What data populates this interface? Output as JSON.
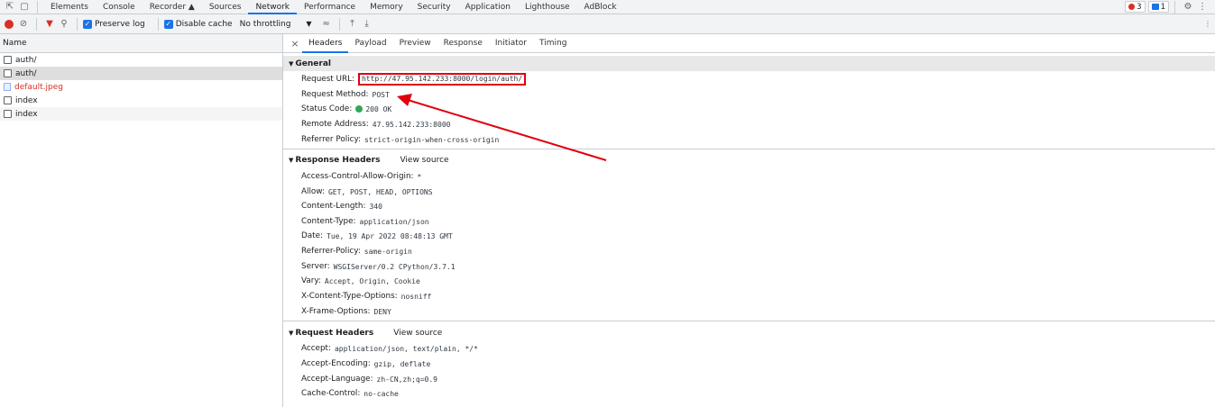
{
  "main_tabs": [
    "Elements",
    "Console",
    "Recorder",
    "Sources",
    "Network",
    "Performance",
    "Memory",
    "Security",
    "Application",
    "Lighthouse",
    "AdBlock"
  ],
  "status": {
    "errors": "3",
    "messages": "1"
  },
  "toolbar": {
    "preserve_log": "Preserve log",
    "disable_cache": "Disable cache",
    "throttling": "No throttling"
  },
  "requests": {
    "header": "Name",
    "items": [
      "auth/",
      "auth/",
      "default.jpeg",
      "index",
      "index"
    ]
  },
  "detail_tabs": [
    "Headers",
    "Payload",
    "Preview",
    "Response",
    "Initiator",
    "Timing"
  ],
  "general": {
    "title": "General",
    "rows": [
      {
        "k": "Request URL:",
        "v": "http://47.95.142.233:8000/login/auth/"
      },
      {
        "k": "Request Method:",
        "v": "POST"
      },
      {
        "k": "Status Code:",
        "v": "200 OK"
      },
      {
        "k": "Remote Address:",
        "v": "47.95.142.233:8000"
      },
      {
        "k": "Referrer Policy:",
        "v": "strict-origin-when-cross-origin"
      }
    ]
  },
  "response_headers": {
    "title": "Response Headers",
    "view_source": "View source",
    "rows": [
      {
        "k": "Access-Control-Allow-Origin:",
        "v": "*"
      },
      {
        "k": "Allow:",
        "v": "GET, POST, HEAD, OPTIONS"
      },
      {
        "k": "Content-Length:",
        "v": "340"
      },
      {
        "k": "Content-Type:",
        "v": "application/json"
      },
      {
        "k": "Date:",
        "v": "Tue, 19 Apr 2022 08:48:13 GMT"
      },
      {
        "k": "Referrer-Policy:",
        "v": "same-origin"
      },
      {
        "k": "Server:",
        "v": "WSGIServer/0.2 CPython/3.7.1"
      },
      {
        "k": "Vary:",
        "v": "Accept, Origin, Cookie"
      },
      {
        "k": "X-Content-Type-Options:",
        "v": "nosniff"
      },
      {
        "k": "X-Frame-Options:",
        "v": "DENY"
      }
    ]
  },
  "request_headers": {
    "title": "Request Headers",
    "view_source": "View source",
    "rows": [
      {
        "k": "Accept:",
        "v": "application/json, text/plain, */*"
      },
      {
        "k": "Accept-Encoding:",
        "v": "gzip, deflate"
      },
      {
        "k": "Accept-Language:",
        "v": "zh-CN,zh;q=0.9"
      },
      {
        "k": "Cache-Control:",
        "v": "no-cache"
      }
    ]
  },
  "colors": {
    "accent": "#1a73e8",
    "annotation": "#e0000f",
    "status_ok": "#34a853"
  }
}
